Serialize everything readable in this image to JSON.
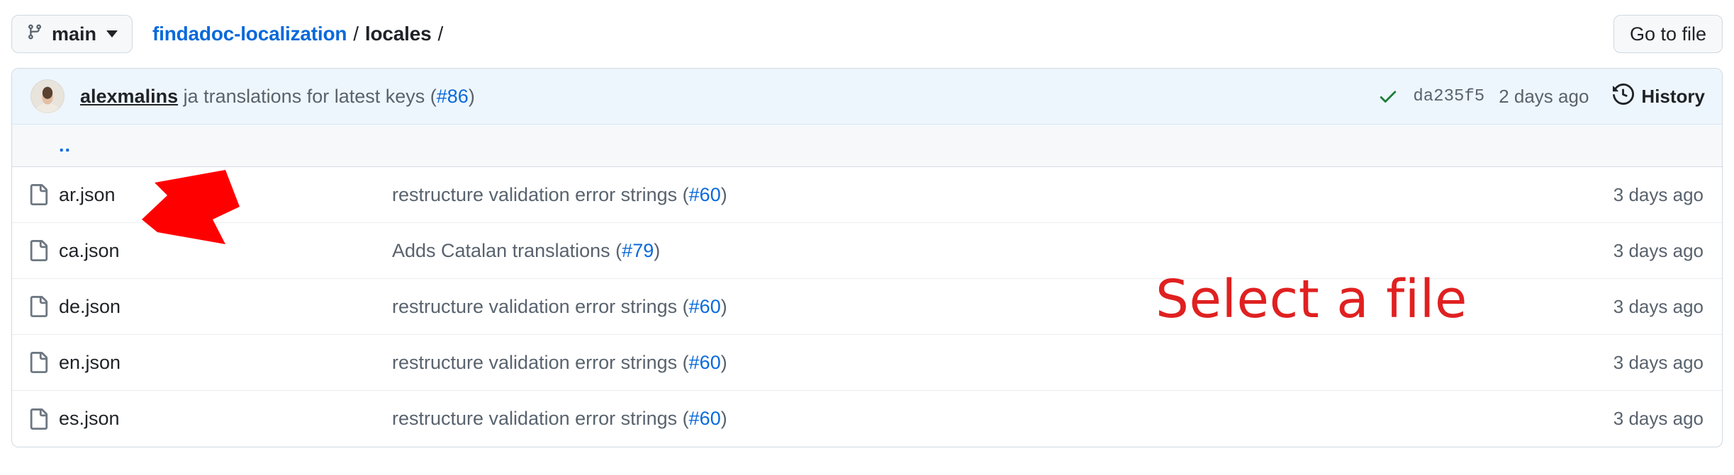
{
  "topbar": {
    "branch_button": {
      "label": "main",
      "icon": "git-branch-icon",
      "caret_icon": "chevron-down-icon"
    },
    "breadcrumb": {
      "repo": "findadoc-localization",
      "separator": "/",
      "current": "locales",
      "trailing_separator": "/"
    },
    "go_to_file_label": "Go to file"
  },
  "commit_bar": {
    "author": "alexmalins",
    "message": "ja translations for latest keys (",
    "pr": "#86",
    "message_end": ")",
    "status_icon": "check-icon",
    "sha": "da235f5",
    "time": "2 days ago",
    "history_label": "History",
    "history_icon": "history-clock-icon"
  },
  "parent_row": {
    "label": "..",
    "name": "parent-directory-link"
  },
  "files": [
    {
      "icon": "file-icon",
      "name": "ar.json",
      "message_prefix": "restructure validation error strings (",
      "pr": "#60",
      "message_suffix": ")",
      "time": "3 days ago"
    },
    {
      "icon": "file-icon",
      "name": "ca.json",
      "message_prefix": "Adds Catalan translations (",
      "pr": "#79",
      "message_suffix": ")",
      "time": "3 days ago"
    },
    {
      "icon": "file-icon",
      "name": "de.json",
      "message_prefix": "restructure validation error strings (",
      "pr": "#60",
      "message_suffix": ")",
      "time": "3 days ago"
    },
    {
      "icon": "file-icon",
      "name": "en.json",
      "message_prefix": "restructure validation error strings (",
      "pr": "#60",
      "message_suffix": ")",
      "time": "3 days ago"
    },
    {
      "icon": "file-icon",
      "name": "es.json",
      "message_prefix": "restructure validation error strings (",
      "pr": "#60",
      "message_suffix": ")",
      "time": "3 days ago"
    }
  ],
  "annotations": {
    "callout_text": "Select a file",
    "arrow_icon": "red-arrow-pointing-down-left",
    "color": "#e02020",
    "arrow_color": "#ff0000"
  },
  "colors": {
    "link": "#0969da",
    "muted_text": "#59636e",
    "border": "#d1d9e0",
    "commit_bar_bg": "#eef6fd",
    "row_alt_bg": "#f6f8fa",
    "success": "#1a7f37"
  }
}
